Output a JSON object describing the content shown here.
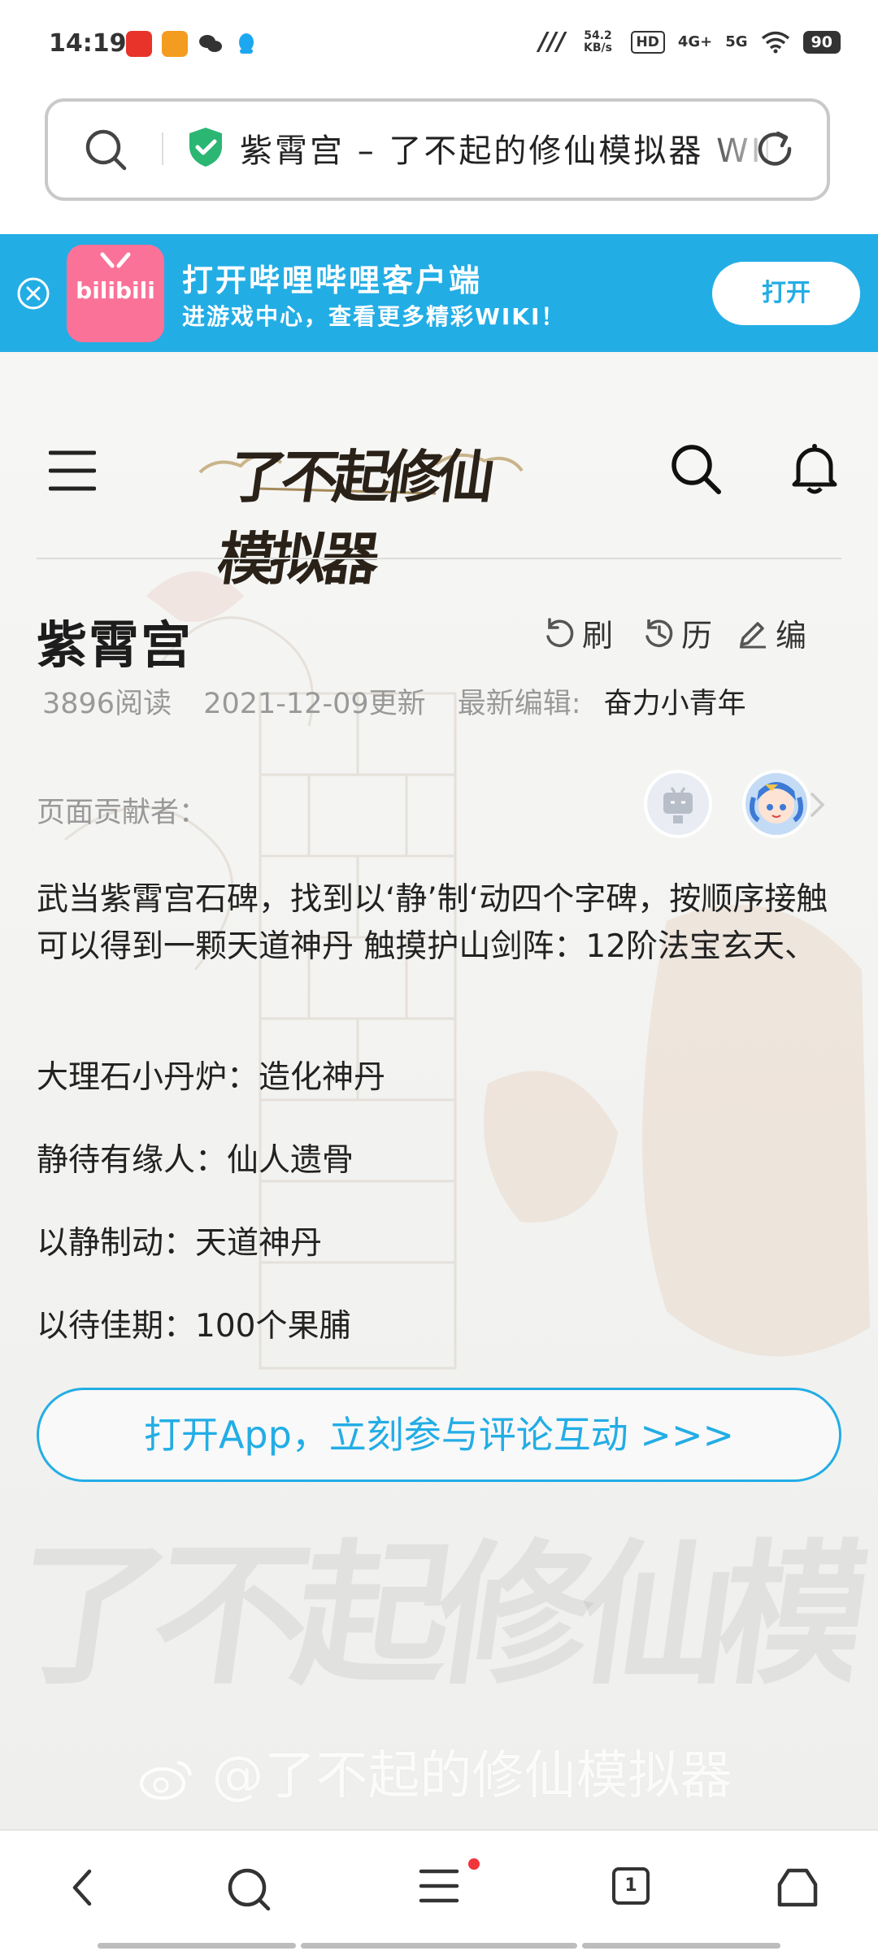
{
  "status_bar": {
    "time": "14:19",
    "network_speed": "54.2 KB/s",
    "hd_label": "HD",
    "signal_1": "4G+",
    "signal_2": "5G",
    "battery": "90",
    "app_icons": [
      "hot-list-icon",
      "weibo-icon",
      "wechat-icon",
      "qq-icon"
    ],
    "colors": {
      "hot_list": "#e8332a",
      "weibo": "#f39c1f",
      "qq": "#1ea7f1"
    }
  },
  "address_bar": {
    "title": "紫霄宫 – 了不起的修仙模拟器 WIKI",
    "secure": true
  },
  "promo_banner": {
    "title": "打开哔哩哔哩客户端",
    "subtitle": "进游戏中心，查看更多精彩WIKI！",
    "open_label": "打开",
    "logo_text": "bilibili",
    "color": "#23ade5"
  },
  "wiki_header": {
    "logo_text": "了不起修仙模拟器"
  },
  "article": {
    "title": "紫霄宫",
    "tools": {
      "refresh": "刷",
      "history": "历",
      "edit": "编"
    },
    "views": "3896阅读",
    "updated": "2021-12-09更新",
    "last_editor_label": "最新编辑:",
    "last_editor": "奋力小青年",
    "contributors_label": "页面贡献者：",
    "paragraphs": [
      "武当紫霄宫石碑，找到以‘静’制‘动四个字碑，按顺序接触可以得到一颗天道神丹 触摸护山剑阵：12阶法宝玄天、",
      "大理石小丹炉：造化神丹",
      "静待有缘人：仙人遗骨",
      "以静制动：天道神丹",
      "以待佳期：100个果脯"
    ]
  },
  "cta": {
    "label": "打开App，立刻参与评论互动 >>>"
  },
  "watermark": {
    "logo_text": "了不起修仙模拟器",
    "weibo_text": "@了不起的修仙模拟器"
  },
  "bottom_nav": {
    "tab_count": "1"
  }
}
